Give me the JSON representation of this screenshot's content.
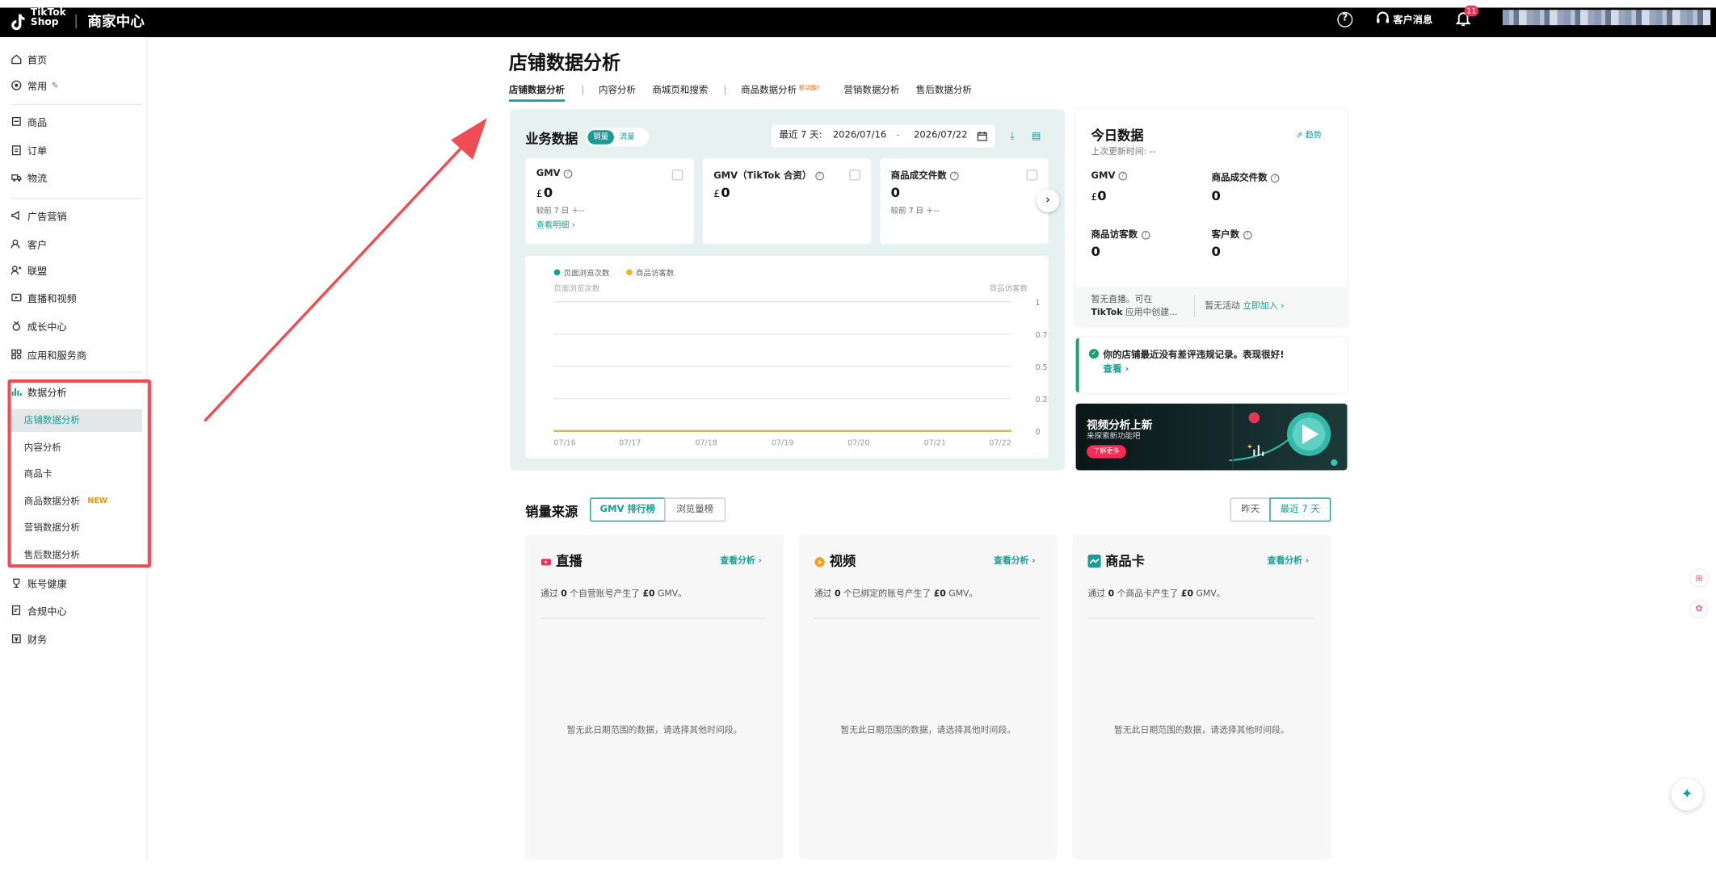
{
  "header": {
    "brand_line1": "TikTok",
    "brand_line2": "Shop",
    "title": "商家中心",
    "customer_msg": "客户消息",
    "bell_badge": "11"
  },
  "sidebar": {
    "items": [
      {
        "label": "首页",
        "icon": "home-icon"
      },
      {
        "label": "常用",
        "icon": "star-icon"
      },
      {
        "label": "商品",
        "icon": "box-icon"
      },
      {
        "label": "订单",
        "icon": "clipboard-icon"
      },
      {
        "label": "物流",
        "icon": "truck-icon"
      },
      {
        "label": "广告营销",
        "icon": "megaphone-icon"
      },
      {
        "label": "客户",
        "icon": "customers-icon"
      },
      {
        "label": "联盟",
        "icon": "affiliate-icon"
      },
      {
        "label": "直播和视频",
        "icon": "video-icon"
      },
      {
        "label": "成长中心",
        "icon": "medal-icon"
      },
      {
        "label": "应用和服务商",
        "icon": "apps-icon"
      },
      {
        "label": "数据分析",
        "icon": "chart-icon"
      },
      {
        "label": "账号健康",
        "icon": "trophy-icon"
      },
      {
        "label": "合规中心",
        "icon": "compliance-icon"
      },
      {
        "label": "财务",
        "icon": "finance-icon"
      }
    ],
    "sub": [
      "店铺数据分析",
      "内容分析",
      "商品卡",
      "商品数据分析",
      "营销数据分析",
      "售后数据分析"
    ],
    "new_tag": "NEW"
  },
  "page": {
    "title": "店铺数据分析",
    "tabs": [
      "店铺数据分析",
      "内容分析",
      "商城页和搜索",
      "商品数据分析",
      "营销数据分析",
      "售后数据分析"
    ],
    "tab_new": "新功能!"
  },
  "business": {
    "title": "业务数据",
    "toggle_on": "销量",
    "toggle_off": "流量",
    "range_label": "最近 7 天:",
    "start_date": "2026/07/16",
    "date_sep": "-",
    "end_date": "2026/07/22",
    "metrics": [
      {
        "label": "GMV",
        "currency": "£",
        "value": "0",
        "compare": "较前 7 日 ＋--",
        "link": "查看明细 ›"
      },
      {
        "label": "GMV（TikTok 合资）",
        "currency": "£",
        "value": "0"
      },
      {
        "label": "商品成交件数",
        "value": "0",
        "compare": "较前 7 日 ＋--"
      }
    ]
  },
  "chart_data": {
    "type": "line",
    "x": [
      "07/16",
      "07/17",
      "07/18",
      "07/19",
      "07/20",
      "07/21",
      "07/22"
    ],
    "series": [
      {
        "name": "页面浏览次数",
        "values": [
          0,
          0,
          0,
          0,
          0,
          0,
          0
        ],
        "color": "#1a9c95"
      },
      {
        "name": "商品访客数",
        "values": [
          0,
          0,
          0,
          0,
          0,
          0,
          0
        ],
        "color": "#f5b12e"
      }
    ],
    "ylabel_left": "页面浏览次数",
    "ylabel_right": "商品访客数",
    "yticks": [
      "1",
      "0.75",
      "0.5",
      "0.25",
      "0"
    ],
    "ylim": [
      0,
      1
    ],
    "grid": true,
    "legend": "top-left"
  },
  "today": {
    "title": "今日数据",
    "updated": "上次更新时间: --",
    "trend": "趋势",
    "items": [
      {
        "label": "GMV",
        "currency": "£",
        "value": "0"
      },
      {
        "label": "商品成交件数",
        "value": "0"
      },
      {
        "label": "商品访客数",
        "value": "0"
      },
      {
        "label": "客户数",
        "value": "0"
      }
    ],
    "live_line1": "暂无直播。可在",
    "live_bold": "TikTok",
    "live_line2": " 应用中创建...",
    "activity": "暂无活动",
    "activity_link": "立即加入 ›"
  },
  "alert": {
    "text": "你的店铺最近没有差评违规记录。表现很好!",
    "link": "查看 ›"
  },
  "banner": {
    "title": "视频分析上新",
    "subtitle": "来探索新功能吧",
    "button": "了解更多"
  },
  "sales": {
    "title": "销量来源",
    "tab_on": "GMV 排行榜",
    "tab_off": "浏览量榜",
    "range_off": "昨天",
    "range_on": "最近 7 天",
    "cards": [
      {
        "title": "直播",
        "link": "查看分析 ›",
        "desc_pre": "通过 ",
        "count": "0",
        "desc_mid": " 个自营账号产生了 ",
        "amount": "£0",
        "desc_post": " GMV。",
        "empty": "暂无此日期范围的数据，请选择其他时间段。",
        "icon": "live-icon",
        "color": "#e8335b"
      },
      {
        "title": "视频",
        "link": "查看分析 ›",
        "desc_pre": "通过 ",
        "count": "0",
        "desc_mid": " 个已绑定的账号产生了 ",
        "amount": "£0",
        "desc_post": " GMV。",
        "empty": "暂无此日期范围的数据，请选择其他时间段。",
        "icon": "video-icon",
        "color": "#f0a31a"
      },
      {
        "title": "商品卡",
        "link": "查看分析 ›",
        "desc_pre": "通过 ",
        "count": "0",
        "desc_mid": " 个商品卡产生了 ",
        "amount": "£0",
        "desc_post": " GMV。",
        "empty": "暂无此日期范围的数据，请选择其他时间段。",
        "icon": "product-card-icon",
        "color": "#1a9c95"
      }
    ]
  }
}
